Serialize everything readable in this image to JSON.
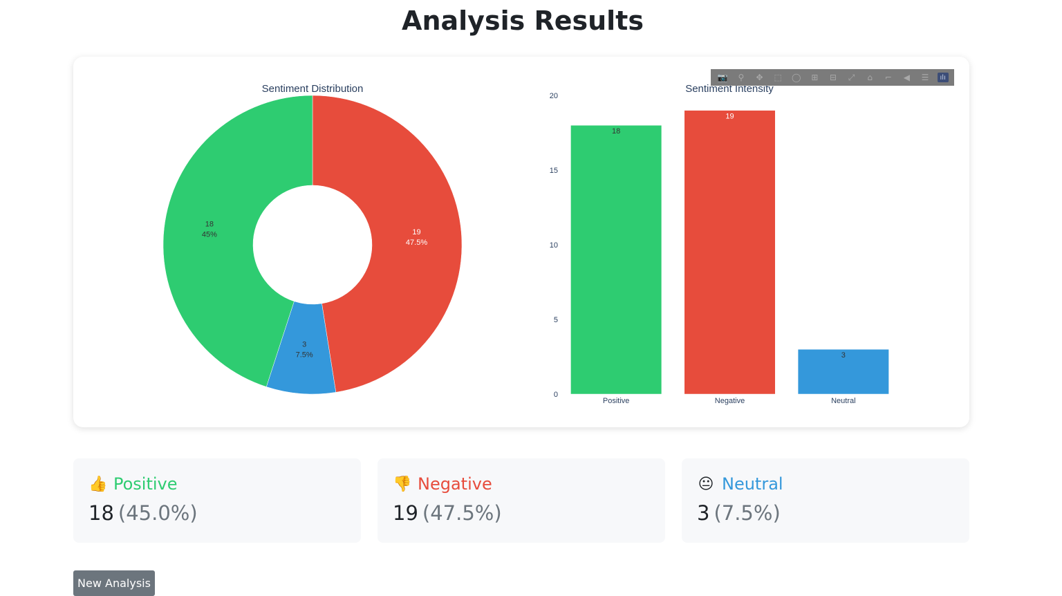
{
  "page": {
    "title": "Analysis Results"
  },
  "colors": {
    "positive": "#2ecc71",
    "negative": "#e74c3c",
    "neutral": "#3498db",
    "button": "#6c757d"
  },
  "modebar": {
    "buttons": [
      {
        "icon": "camera-icon",
        "glyph": "📷"
      },
      {
        "icon": "zoom-icon",
        "glyph": "⚲"
      },
      {
        "icon": "pan-icon",
        "glyph": "✥"
      },
      {
        "icon": "box-select-icon",
        "glyph": "⬚"
      },
      {
        "icon": "lasso-select-icon",
        "glyph": "◯"
      },
      {
        "icon": "zoom-in-icon",
        "glyph": "⊞"
      },
      {
        "icon": "zoom-out-icon",
        "glyph": "⊟"
      },
      {
        "icon": "autoscale-icon",
        "glyph": "⤢"
      },
      {
        "icon": "reset-axes-icon",
        "glyph": "⌂"
      },
      {
        "icon": "spike-lines-icon",
        "glyph": "⌐"
      },
      {
        "icon": "hover-closest-icon",
        "glyph": "◀"
      },
      {
        "icon": "hover-compare-icon",
        "glyph": "☰"
      },
      {
        "icon": "plotly-logo-icon",
        "glyph": "ılı"
      }
    ]
  },
  "chart_data": [
    {
      "type": "pie",
      "hole": true,
      "title": "Sentiment Distribution",
      "slices": [
        {
          "label": "Negative",
          "value": 19,
          "percent": "47.5%",
          "color": "#e74c3c",
          "text_color": "#ffffff"
        },
        {
          "label": "Neutral",
          "value": 3,
          "percent": "7.5%",
          "color": "#3498db",
          "text_color": "#333333"
        },
        {
          "label": "Positive",
          "value": 18,
          "percent": "45%",
          "color": "#2ecc71",
          "text_color": "#333333"
        }
      ]
    },
    {
      "type": "bar",
      "title": "Sentiment Intensity",
      "categories": [
        "Positive",
        "Negative",
        "Neutral"
      ],
      "values": [
        18,
        19,
        3
      ],
      "colors": [
        "#2ecc71",
        "#e74c3c",
        "#3498db"
      ],
      "label_colors": [
        "#333333",
        "#ffffff",
        "#333333"
      ],
      "ylim": [
        0,
        20
      ],
      "yticks": [
        0,
        5,
        10,
        15,
        20
      ]
    }
  ],
  "stats": [
    {
      "emoji": "👍",
      "label": "Positive",
      "count": "18",
      "pct": "(45.0%)",
      "color": "#2ecc71"
    },
    {
      "emoji": "👎",
      "label": "Negative",
      "count": "19",
      "pct": "(47.5%)",
      "color": "#e74c3c"
    },
    {
      "emoji": "😐",
      "label": "Neutral",
      "count": "3",
      "pct": "(7.5%)",
      "color": "#3498db"
    }
  ],
  "actions": {
    "new_analysis": "New Analysis"
  }
}
